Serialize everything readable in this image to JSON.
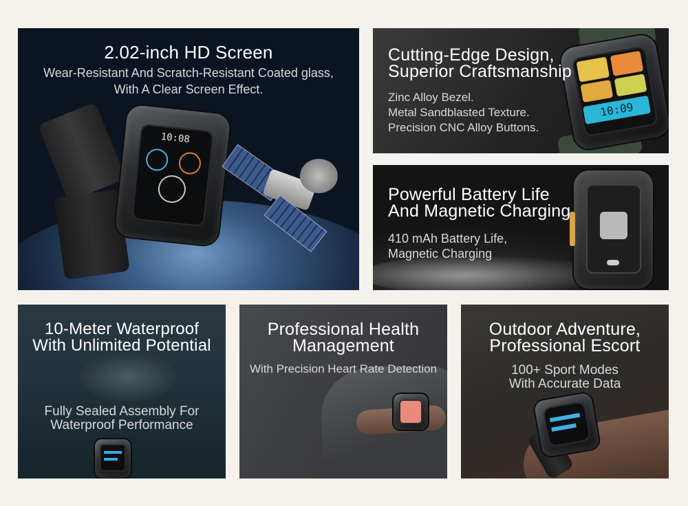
{
  "panels": {
    "hd_screen": {
      "title": "2.02-inch HD Screen",
      "line1": "Wear-Resistant And Scratch-Resistant Coated glass,",
      "line2": "With A Clear Screen Effect.",
      "watch_time": "10:08"
    },
    "design": {
      "title_line1": "Cutting-Edge Design,",
      "title_line2": "Superior Craftsmanship",
      "line1": "Zinc Alloy Bezel.",
      "line2": "Metal Sandblasted Texture.",
      "line3": "Precision CNC Alloy Buttons.",
      "watch_time": "10:09"
    },
    "battery": {
      "title_line1": "Powerful Battery Life",
      "title_line2": "And Magnetic Charging",
      "line1": "410 mAh Battery Life,",
      "line2": "Magnetic Charging"
    },
    "waterproof": {
      "title_line1": "10-Meter Waterproof",
      "title_line2": "With Unlimited Potential",
      "line1": "Fully Sealed Assembly For",
      "line2": "Waterproof Performance"
    },
    "health": {
      "title_line1": "Professional Health",
      "title_line2": "Management",
      "line1": "With Precision Heart Rate Detection"
    },
    "outdoor": {
      "title_line1": "Outdoor Adventure,",
      "title_line2": "Professional Escort",
      "line1": "100+ Sport Modes",
      "line2": "With Accurate Data"
    }
  }
}
